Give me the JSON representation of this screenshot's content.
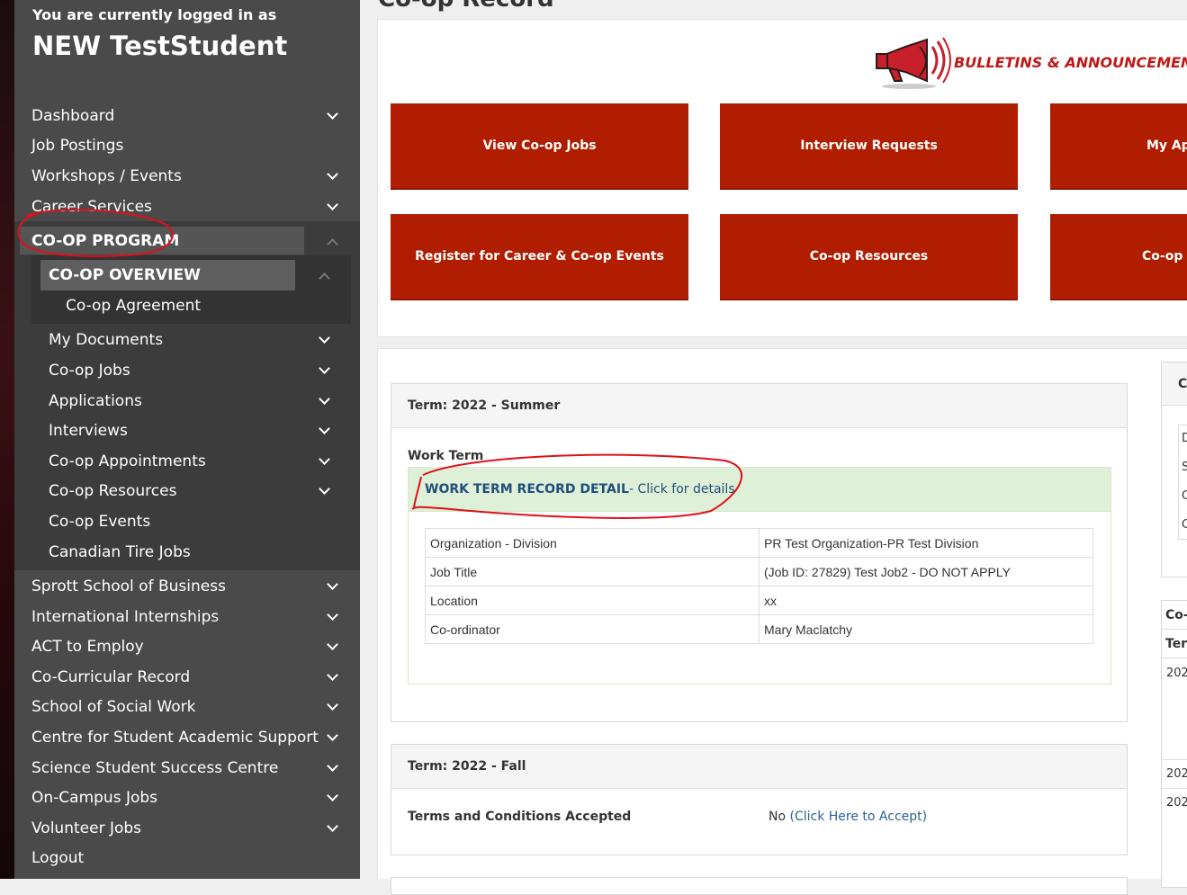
{
  "sidebar": {
    "logged_in_label": "You are currently logged in as",
    "user_name": "NEW TestStudent",
    "items": {
      "dashboard": "Dashboard",
      "job_postings": "Job Postings",
      "workshops": "Workshops / Events",
      "career_services": "Career Services",
      "coop_program": "CO-OP PROGRAM",
      "coop_overview": "CO-OP OVERVIEW",
      "coop_agreement": "Co-op Agreement",
      "my_documents": "My Documents",
      "coop_jobs": "Co-op Jobs",
      "applications": "Applications",
      "interviews": "Interviews",
      "coop_appointments": "Co-op Appointments",
      "coop_resources": "Co-op Resources",
      "coop_events": "Co-op Events",
      "canadian_tire": "Canadian Tire Jobs",
      "sprott": "Sprott School of Business",
      "intl_internships": "International Internships",
      "act_employ": "ACT to Employ",
      "co_curricular": "Co-Curricular Record",
      "social_work": "School of Social Work",
      "academic_support": "Centre for Student Academic Support",
      "science_success": "Science Student Success Centre",
      "on_campus": "On-Campus Jobs",
      "volunteer": "Volunteer Jobs",
      "logout": "Logout"
    }
  },
  "main": {
    "page_title": "Co-op Record",
    "bulletin": "BULLETINS & ANNOUNCEMENTS",
    "tiles": {
      "view_jobs": "View Co-op Jobs",
      "interview_requests": "Interview Requests",
      "my_apps": "My Ap",
      "register_events": "Register for Career & Co-op Events",
      "resources": "Co-op Resources",
      "coop_a": "Co-op A"
    },
    "term1": {
      "header": "Term: 2022 - Summer",
      "work_term_label": "Work Term",
      "detail_link": "WORK TERM RECORD DETAIL",
      "detail_suffix": " - Click for details",
      "rows": [
        {
          "label": "Organization - Division",
          "value": "PR Test Organization-PR Test Division"
        },
        {
          "label": "Job Title",
          "value": "(Job ID: 27829) Test Job2 - DO NOT APPLY"
        },
        {
          "label": "Location",
          "value": "xx"
        },
        {
          "label": "Co-ordinator",
          "value": "Mary Maclatchy"
        }
      ]
    },
    "term2": {
      "header": "Term: 2022 - Fall",
      "tc_label": "Terms and Conditions Accepted",
      "tc_value": "No ",
      "tc_link": "(Click Here to Accept)"
    },
    "right": {
      "card1_title": "C",
      "card1_rows": [
        "D",
        "S",
        "C",
        "C"
      ],
      "card2_title": "Co-",
      "card2_col": "Terr",
      "card2_rows": [
        "202",
        "202",
        "202"
      ]
    }
  },
  "colors": {
    "sidebar_bg": "#4a4a4a",
    "tile_red": "#b11d00",
    "annotation_red": "#e0101a",
    "success_bg": "#dff0d8"
  }
}
